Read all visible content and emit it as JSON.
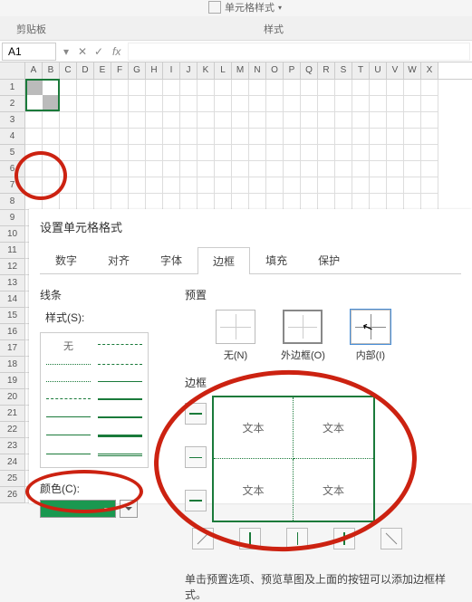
{
  "ribbon": {
    "clipboard_label": "剪贴板",
    "styles_label": "样式",
    "cell_format_label": "单元格样式"
  },
  "namebox": {
    "value": "A1",
    "fx": "fx"
  },
  "columns": [
    "A",
    "B",
    "C",
    "D",
    "E",
    "F",
    "G",
    "H",
    "I",
    "J",
    "K",
    "L",
    "M",
    "N",
    "O",
    "P",
    "Q",
    "R",
    "S",
    "T",
    "U",
    "V",
    "W",
    "X"
  ],
  "rows": [
    "1",
    "2",
    "3",
    "4",
    "5",
    "6",
    "7",
    "8",
    "9",
    "10",
    "11",
    "12",
    "13",
    "14",
    "15",
    "16",
    "17",
    "18",
    "19",
    "20",
    "21",
    "22",
    "23",
    "24",
    "25",
    "26"
  ],
  "dialog": {
    "title": "设置单元格格式",
    "tabs": {
      "number": "数字",
      "align": "对齐",
      "font": "字体",
      "border": "边框",
      "fill": "填充",
      "protect": "保护"
    },
    "line_section": "线条",
    "style_label": "样式(S):",
    "style_none": "无",
    "color_label": "颜色(C):",
    "color_value": "#1a9850",
    "preset_section": "预置",
    "presets": {
      "none": "无(N)",
      "outline": "外边框(O)",
      "inner": "内部(I)"
    },
    "border_section": "边框",
    "preview_cells": [
      "文本",
      "文本",
      "文本",
      "文本"
    ],
    "hint": "单击预置选项、预览草图及上面的按钮可以添加边框样式。"
  }
}
